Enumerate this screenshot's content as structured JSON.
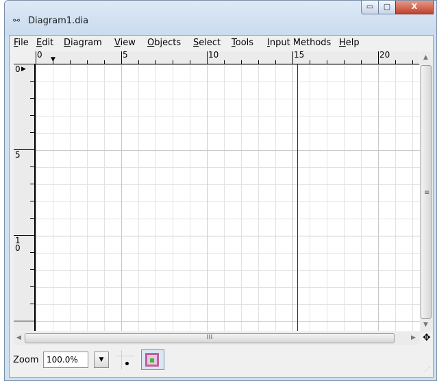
{
  "window": {
    "title": "Diagram1.dia",
    "minimize": "▭",
    "maximize": "▢",
    "close": "X"
  },
  "menu": [
    "File",
    "Edit",
    "Diagram",
    "View",
    "Objects",
    "Select",
    "Tools",
    "Input Methods",
    "Help"
  ],
  "rulers": {
    "horizontal_labels": [
      "0",
      "5",
      "10",
      "15",
      "20"
    ],
    "vertical_labels": [
      "0",
      "5",
      "10"
    ]
  },
  "scrollbar": {
    "up": "▲",
    "down": "▼",
    "left": "◀",
    "right": "▶",
    "hgrip": "III",
    "vgrip": "≡"
  },
  "status": {
    "zoom_label": "Zoom",
    "zoom_value": "100.0%",
    "zoom_dropdown": "▼"
  },
  "icons": {
    "app": "diagram-app-icon",
    "navigate": "✥"
  },
  "colors": {
    "guide_line": "#1f2f8a",
    "grid_major": "#c8c8c8",
    "grid_minor": "#e2e2e2"
  }
}
